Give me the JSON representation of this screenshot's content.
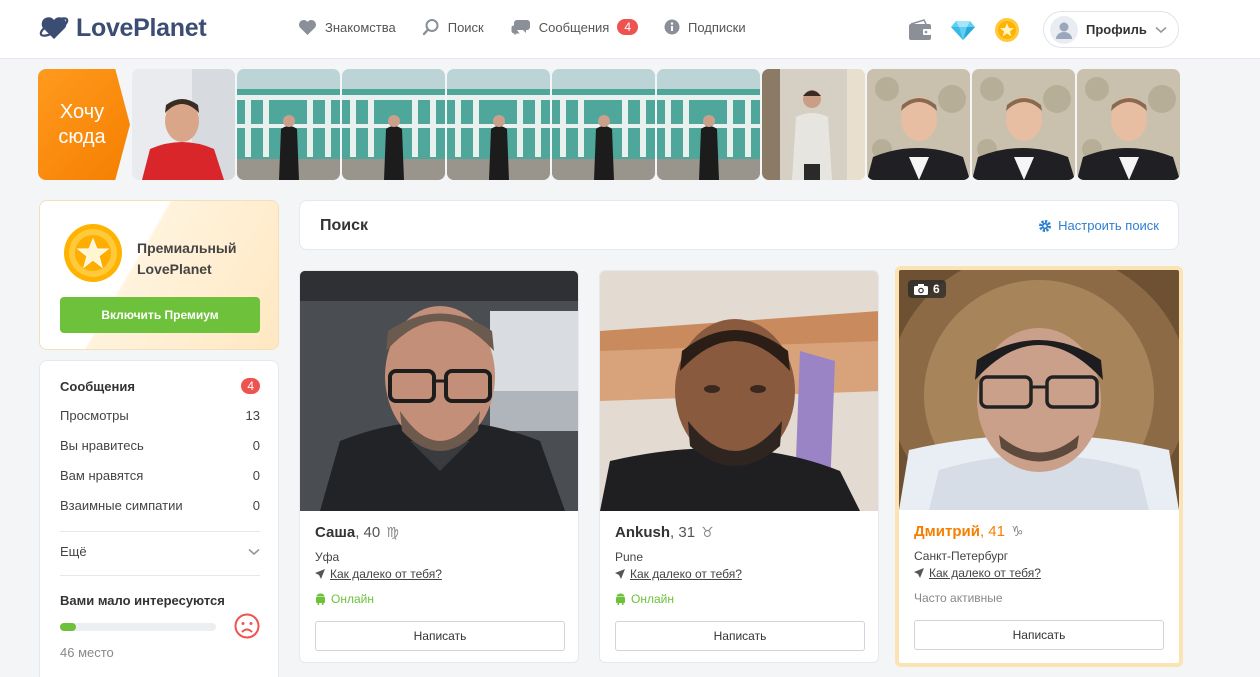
{
  "header": {
    "logo_text": "LovePlanet",
    "nav": [
      {
        "label": "Знакомства",
        "icon": "heart-icon"
      },
      {
        "label": "Поиск",
        "icon": "search-icon"
      },
      {
        "label": "Сообщения",
        "icon": "chat-icon",
        "badge": "4"
      },
      {
        "label": "Подписки",
        "icon": "info-icon"
      }
    ],
    "icons": [
      "wallet-icon",
      "diamond-icon",
      "star-coin-icon"
    ],
    "profile_label": "Профиль"
  },
  "strip": {
    "want_here_label": "Хочу сюда"
  },
  "premium": {
    "title_line1": "Премиальный",
    "title_line2": "LovePlanet",
    "button_label": "Включить Премиум"
  },
  "stats": {
    "items": [
      {
        "label": "Сообщения",
        "value": "4"
      },
      {
        "label": "Просмотры",
        "value": "13"
      },
      {
        "label": "Вы нравитесь",
        "value": "0"
      },
      {
        "label": "Вам нравятся",
        "value": "0"
      },
      {
        "label": "Взаимные симпатии",
        "value": "0"
      }
    ],
    "more_label": "Ещё",
    "interest_title": "Вами мало интересуются",
    "interest_progress": 0.1,
    "rank_label": "46 место"
  },
  "search": {
    "title": "Поиск",
    "settings_label": "Настроить поиск"
  },
  "cards": [
    {
      "name": "Саша",
      "age": ", 40",
      "sign": "♍",
      "city": "Уфа",
      "distance_label": "Как далеко от тебя?",
      "status": "Онлайн",
      "online": true,
      "button_label": "Написать"
    },
    {
      "name": "Ankush",
      "age": ", 31",
      "sign": "♉",
      "city": "Pune",
      "distance_label": "Как далеко от тебя?",
      "status": "Онлайн",
      "online": true,
      "button_label": "Написать"
    },
    {
      "name": "Дмитрий",
      "age": ", 41",
      "sign": "♑",
      "city": "Санкт-Петербург",
      "distance_label": "Как далеко от тебя?",
      "status": "Часто активные",
      "online": false,
      "button_label": "Написать",
      "photo_count": "6"
    }
  ],
  "colors": {
    "accent_orange": "#f57f00",
    "online_green": "#6dc13b",
    "badge_red": "#ef5350",
    "link_blue": "#2f7fd1",
    "brand_navy": "#3b4d73"
  }
}
